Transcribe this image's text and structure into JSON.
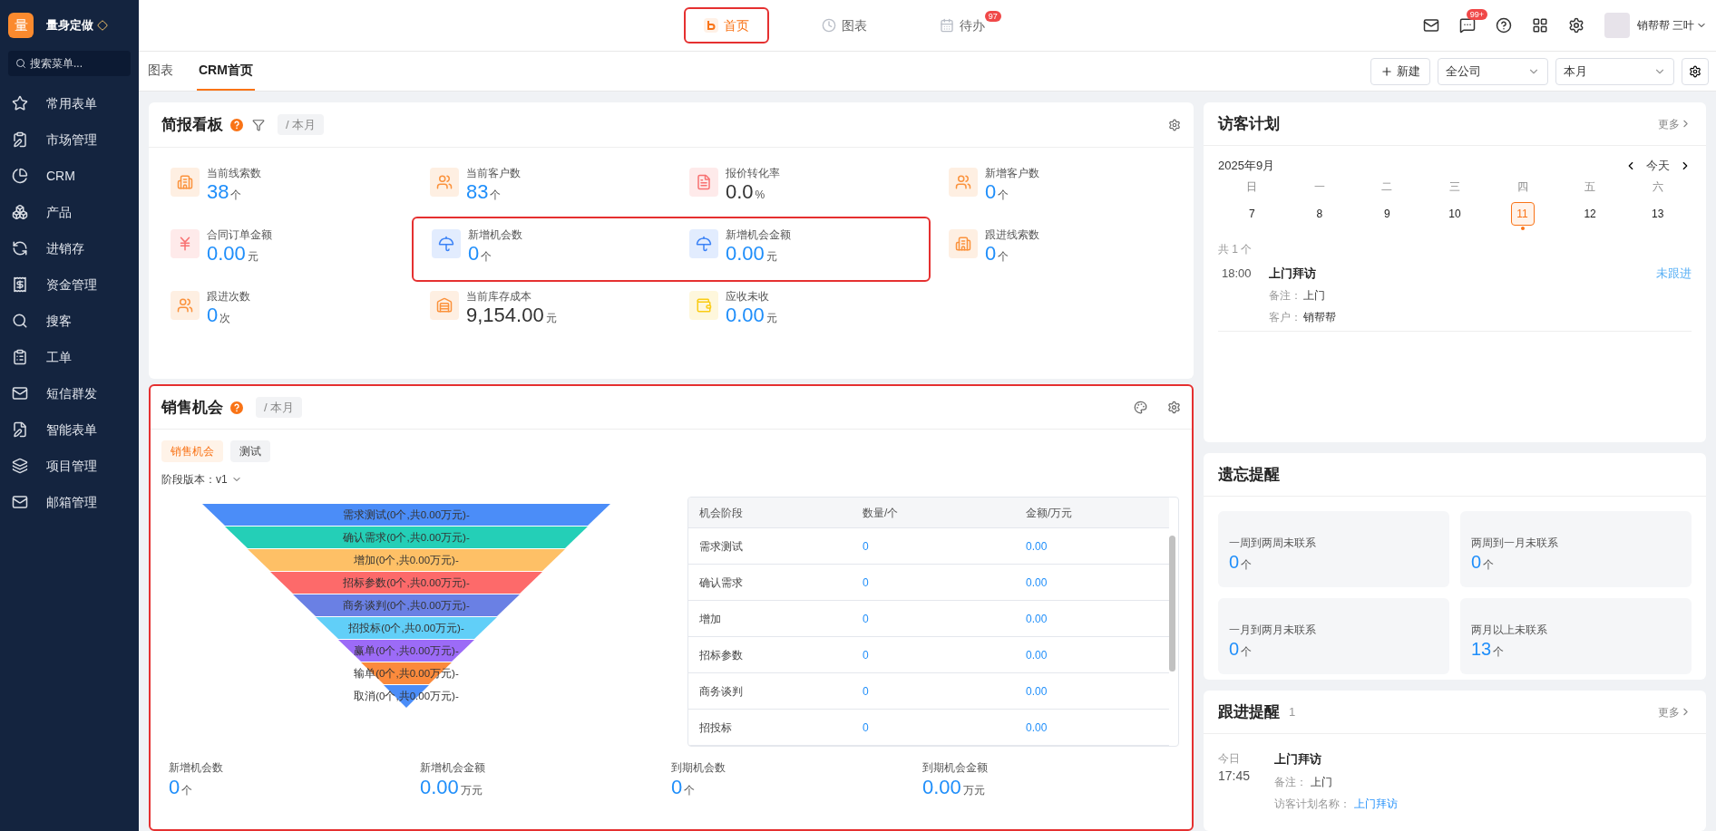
{
  "brand": {
    "logo": "量",
    "name": "量身定做"
  },
  "sidebar": {
    "search": {
      "placeholder": "搜索菜单..."
    },
    "items": [
      {
        "label": "常用表单"
      },
      {
        "label": "市场管理"
      },
      {
        "label": "CRM"
      },
      {
        "label": "产品"
      },
      {
        "label": "进销存"
      },
      {
        "label": "资金管理"
      },
      {
        "label": "搜客"
      },
      {
        "label": "工单"
      },
      {
        "label": "短信群发"
      },
      {
        "label": "智能表单"
      },
      {
        "label": "项目管理"
      },
      {
        "label": "邮箱管理"
      }
    ]
  },
  "top_nav": [
    {
      "label": "首页",
      "selected": true,
      "highlighted": true
    },
    {
      "label": "图表",
      "selected": false,
      "highlighted": false
    },
    {
      "label": "待办",
      "selected": false,
      "highlighted": false,
      "badge": "97"
    }
  ],
  "toolbar": {
    "message_badge": "99+",
    "user": "销帮帮 三叶"
  },
  "page_tabs": [
    {
      "label": "图表",
      "selected": false
    },
    {
      "label": "CRM首页",
      "selected": true
    }
  ],
  "page_actions": {
    "new": "新建",
    "scope": "全公司",
    "period": "本月"
  },
  "briefing": {
    "title": "简报看板",
    "period": "/ 本月",
    "rows": [
      [
        {
          "label": "当前线索数",
          "value": "38",
          "unit": "个",
          "kind": "building",
          "color": "#fb923c",
          "accent": true,
          "highlighted": false
        },
        {
          "label": "当前客户数",
          "value": "83",
          "unit": "个",
          "kind": "users",
          "color": "#fb923c",
          "accent": true,
          "highlighted": false
        },
        {
          "label": "报价转化率",
          "value": "0.0",
          "unit": "%",
          "kind": "document",
          "color": "#f87171",
          "accent": false,
          "highlighted": false
        },
        {
          "label": "新增客户数",
          "value": "0",
          "unit": "个",
          "kind": "users",
          "color": "#fb923c",
          "accent": true,
          "highlighted": false
        }
      ],
      [
        {
          "label": "合同订单金额",
          "value": "0.00",
          "unit": "元",
          "kind": "yen",
          "color": "#f87171",
          "accent": true,
          "highlighted": false
        },
        {
          "label": "新增机会数",
          "value": "0",
          "unit": "个",
          "kind": "umbrella",
          "color": "#3b82f6",
          "accent": true,
          "highlighted": true
        },
        {
          "label": "新增机会金额",
          "value": "0.00",
          "unit": "元",
          "kind": "umbrella",
          "color": "#3b82f6",
          "accent": true,
          "highlighted": true
        },
        {
          "label": "跟进线索数",
          "value": "0",
          "unit": "个",
          "kind": "building",
          "color": "#fb923c",
          "accent": true,
          "highlighted": false
        }
      ],
      [
        {
          "label": "跟进次数",
          "value": "0",
          "unit": "次",
          "kind": "users",
          "color": "#fb923c",
          "accent": true,
          "highlighted": false
        },
        {
          "label": "当前库存成本",
          "value": "9,154.00",
          "unit": "元",
          "kind": "warehouse",
          "color": "#fb923c",
          "accent": false,
          "highlighted": false
        },
        {
          "label": "应收未收",
          "value": "0.00",
          "unit": "元",
          "kind": "wallet",
          "color": "#facc15",
          "accent": true,
          "highlighted": false
        }
      ]
    ]
  },
  "sales": {
    "title": "销售机会",
    "period": "/ 本月",
    "highlighted": true,
    "tabs": [
      {
        "label": "销售机会",
        "selected": true
      },
      {
        "label": "测试",
        "selected": false
      }
    ],
    "version": "阶段版本：v1",
    "funnel": [
      {
        "label": "需求测试(0个,共0.00万元)-",
        "color": "#4b8df8"
      },
      {
        "label": "确认需求(0个,共0.00万元)-",
        "color": "#24cfb7"
      },
      {
        "label": "增加(0个,共0.00万元)-",
        "color": "#fec066"
      },
      {
        "label": "招标参数(0个,共0.00万元)-",
        "color": "#fd6a6a"
      },
      {
        "label": "商务谈判(0个,共0.00万元)-",
        "color": "#6a80e4"
      },
      {
        "label": "招投标(0个,共0.00万元)-",
        "color": "#61cff8"
      },
      {
        "label": "赢单(0个,共0.00万元)-",
        "color": "#9c6bf7"
      },
      {
        "label": "输单(0个,共0.00万元)-",
        "color": "#fb8a3c"
      },
      {
        "label": "取消(0个,共0.00万元)-",
        "color": "#4b8df8"
      }
    ],
    "table": {
      "columns": [
        "机会阶段",
        "数量/个",
        "金额/万元"
      ],
      "rows": [
        [
          "需求测试",
          "0",
          "0.00"
        ],
        [
          "确认需求",
          "0",
          "0.00"
        ],
        [
          "增加",
          "0",
          "0.00"
        ],
        [
          "招标参数",
          "0",
          "0.00"
        ],
        [
          "商务谈判",
          "0",
          "0.00"
        ],
        [
          "招投标",
          "0",
          "0.00"
        ]
      ]
    },
    "stats": [
      {
        "label": "新增机会数",
        "value": "0",
        "unit": "个"
      },
      {
        "label": "新增机会金额",
        "value": "0.00",
        "unit": "万元"
      },
      {
        "label": "到期机会数",
        "value": "0",
        "unit": "个"
      },
      {
        "label": "到期机会金额",
        "value": "0.00",
        "unit": "万元"
      }
    ]
  },
  "visit_plan": {
    "title": "访客计划",
    "more": "更多",
    "month": "2025年9月",
    "today": "今天",
    "days": [
      {
        "weekday": "日",
        "date": "7",
        "selected": false,
        "has_event": false
      },
      {
        "weekday": "一",
        "date": "8",
        "selected": false,
        "has_event": false
      },
      {
        "weekday": "二",
        "date": "9",
        "selected": false,
        "has_event": false
      },
      {
        "weekday": "三",
        "date": "10",
        "selected": false,
        "has_event": false
      },
      {
        "weekday": "四",
        "date": "11",
        "selected": true,
        "has_event": true
      },
      {
        "weekday": "五",
        "date": "12",
        "selected": false,
        "has_event": false
      },
      {
        "weekday": "六",
        "date": "13",
        "selected": false,
        "has_event": false
      }
    ],
    "count": "共 1 个",
    "events": [
      {
        "time": "18:00",
        "title": "上门拜访",
        "status": "未跟进",
        "fields": [
          {
            "label": "备注：",
            "value": "上门"
          },
          {
            "label": "客户：",
            "value": "销帮帮"
          }
        ]
      }
    ]
  },
  "forgotten": {
    "title": "遗忘提醒",
    "items": [
      {
        "label": "一周到两周未联系",
        "value": "0",
        "unit": "个"
      },
      {
        "label": "两周到一月未联系",
        "value": "0",
        "unit": "个"
      },
      {
        "label": "一月到两月未联系",
        "value": "0",
        "unit": "个"
      },
      {
        "label": "两月以上未联系",
        "value": "13",
        "unit": "个"
      }
    ]
  },
  "follow_up": {
    "title": "跟进提醒",
    "count": "1",
    "more": "更多",
    "items": [
      {
        "day": "今日",
        "time": "17:45",
        "title": "上门拜访",
        "note_label": "备注：",
        "note": "上门",
        "plan_label": "访客计划名称：",
        "plan": "上门拜访"
      }
    ]
  }
}
